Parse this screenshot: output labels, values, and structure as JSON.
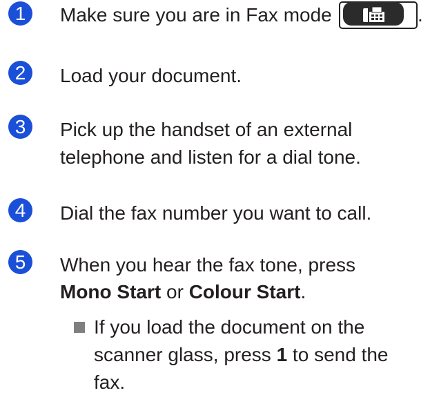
{
  "steps": [
    {
      "number": "1",
      "text": "Make sure you are in Fax mode",
      "end": "."
    },
    {
      "number": "2",
      "text": "Load your document."
    },
    {
      "number": "3",
      "lines": [
        "Pick up the handset of an external",
        "telephone and listen for a dial tone."
      ]
    },
    {
      "number": "4",
      "text": "Dial the fax number you want to call."
    },
    {
      "number": "5",
      "line1": "When you hear the fax tone, press",
      "mono_start": "Mono Start",
      "or": " or ",
      "colour_start": "Colour Start",
      "end": "."
    }
  ],
  "bullet": {
    "line1": "If you load the document on the",
    "line2_a": "scanner glass, press ",
    "key": "1",
    "line2_b": " to send the",
    "line3": "fax."
  },
  "icons": {
    "fax_key": "fax-icon",
    "bullet": "square-bullet-icon"
  },
  "colors": {
    "badge": "#1a4fd8",
    "text": "#231f20",
    "bullet": "#7f7f7f",
    "key": "#2b2b2b"
  }
}
